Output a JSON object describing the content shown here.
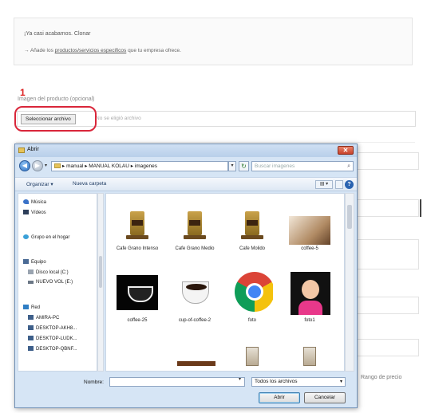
{
  "form": {
    "info_line1": "¡Ya casi acabamos. Clonar",
    "info_line2_prefix": "→ Añade los",
    "info_line2_link": "productos/servicios especificos",
    "info_line2_suffix": "que tu empresa ofrece.",
    "step_number": "1",
    "image_label": "Imagen del producto (opcional)",
    "file_button": "Seleccionar archivo",
    "file_status": "No se eligió archivo",
    "side_text": "Rango de precio"
  },
  "dialog": {
    "title": "Abrir",
    "close": "✕",
    "address": "▸ manual ▸ MANUAL KOLAU ▸ imagenes",
    "search_placeholder": "Buscar imagenes",
    "toolbar": {
      "organize": "Organizar ▾",
      "new_folder": "Nueva carpeta"
    },
    "nav_items": [
      {
        "label": "Música",
        "icon": "music-icon"
      },
      {
        "label": "Vídeos",
        "icon": "video-icon"
      },
      {
        "label": "Grupo en el hogar",
        "icon": "homegroup-icon"
      },
      {
        "label": "Equipo",
        "icon": "computer-icon"
      },
      {
        "label": "Disco local (C:)",
        "icon": "disk-icon"
      },
      {
        "label": "NUEVO VOL (E:)",
        "icon": "drive-icon"
      },
      {
        "label": "Red",
        "icon": "network-icon"
      },
      {
        "label": "AMIRA-PC",
        "icon": "pc-icon"
      },
      {
        "label": "DESKTOP-AKH8...",
        "icon": "pc-icon"
      },
      {
        "label": "DESKTOP-LUDK...",
        "icon": "pc-icon"
      },
      {
        "label": "DESKTOP-QBNF...",
        "icon": "pc-icon"
      }
    ],
    "files": [
      {
        "name": "Cafe Grano Intenso",
        "kind": "bag"
      },
      {
        "name": "Cafe Grano Medio",
        "kind": "bag"
      },
      {
        "name": "Cafe Molido",
        "kind": "bag"
      },
      {
        "name": "coffee-5",
        "kind": "photo"
      },
      {
        "name": "coffee-25",
        "kind": "cup-dark"
      },
      {
        "name": "cup-of-coffee-2",
        "kind": "cup-white"
      },
      {
        "name": "foto",
        "kind": "chrome"
      },
      {
        "name": "foto1",
        "kind": "person"
      }
    ],
    "name_label": "Nombre:",
    "name_value": "",
    "filter": "Todos los archivos",
    "open_button": "Abrir",
    "cancel_button": "Cancelar"
  }
}
